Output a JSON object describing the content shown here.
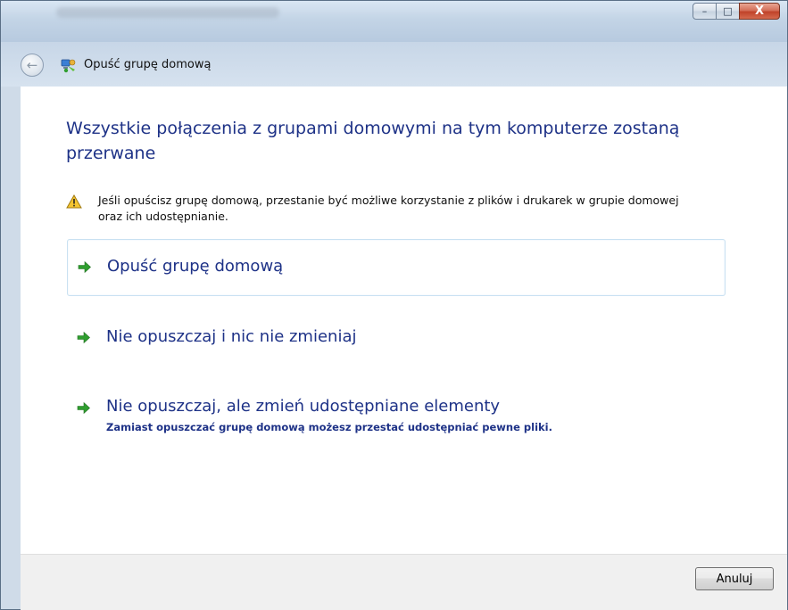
{
  "window": {
    "title_bar": {
      "minimize_glyph": "–",
      "maximize_glyph": "□",
      "close_glyph": "X"
    },
    "nav": {
      "back_icon": "back-arrow-icon",
      "homegroup_icon": "homegroup-icon",
      "title": "Opuść grupę domową"
    }
  },
  "main": {
    "heading": "Wszystkie połączenia z grupami domowymi na tym komputerze zostaną przerwane",
    "warning": {
      "icon": "warning-icon",
      "text": "Jeśli opuścisz grupę domową, przestanie być możliwe korzystanie z plików i drukarek w grupie domowej oraz ich udostępnianie."
    },
    "options": [
      {
        "label": "Opuść grupę domową",
        "icon": "green-arrow-icon",
        "selected": true
      },
      {
        "label": "Nie opuszczaj i nic nie zmieniaj",
        "icon": "green-arrow-icon"
      },
      {
        "label": "Nie opuszczaj, ale zmień udostępniane elementy",
        "sub": "Zamiast opuszczać grupę domową możesz przestać udostępniać pewne pliki.",
        "icon": "green-arrow-icon"
      }
    ]
  },
  "footer": {
    "cancel_label": "Anuluj"
  },
  "colors": {
    "accent_blue": "#1e3287",
    "arrow_green": "#2f9e2f",
    "warning_yellow": "#f4c430"
  }
}
